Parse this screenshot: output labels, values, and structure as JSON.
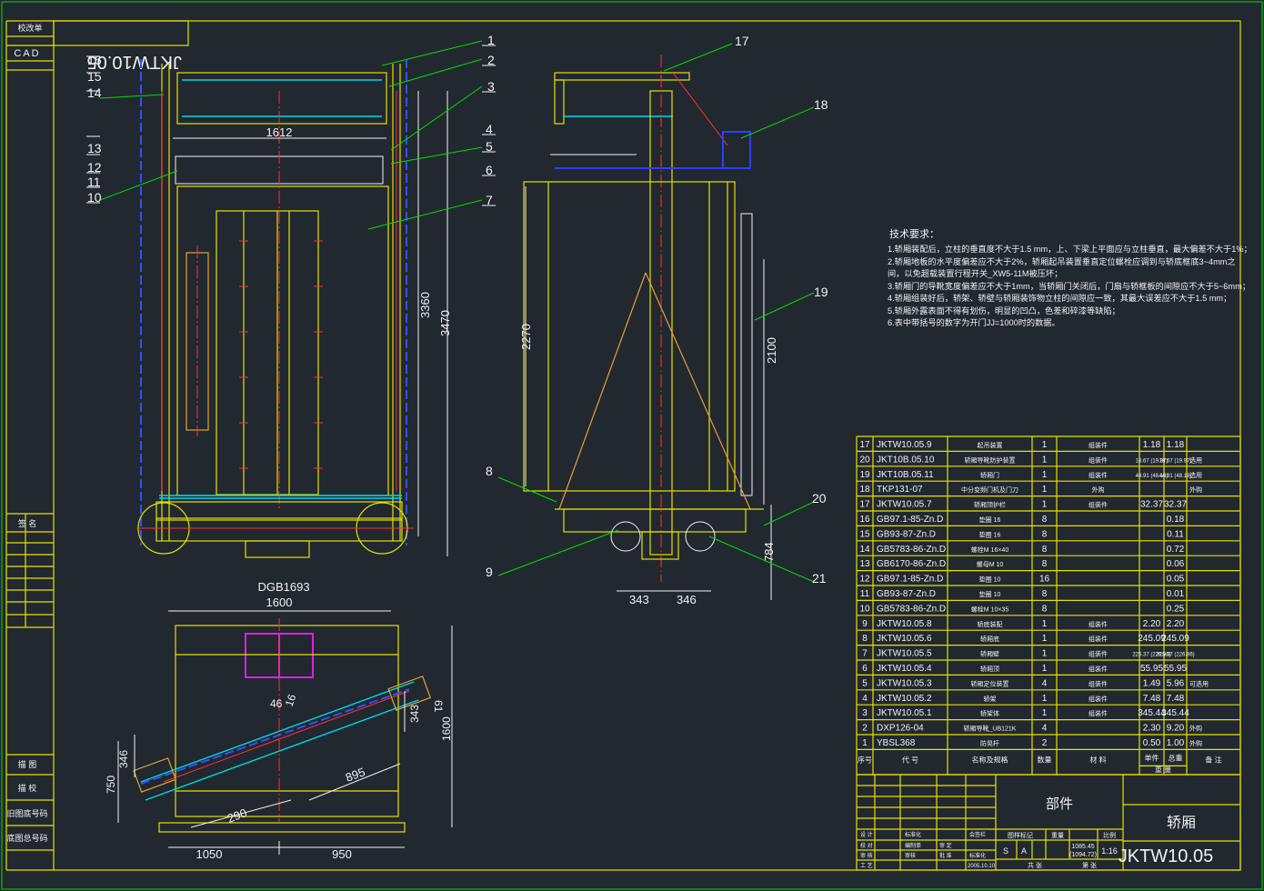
{
  "title_block": {
    "drawing_code_mirror": "JKTW10.05",
    "drawing_code": "JKTW10.05",
    "part_name": "轿厢",
    "category": "部件",
    "scale": "1:16",
    "stage_s": "S",
    "stage_a": "A",
    "mass": "1085.45",
    "mass2": "(1094.72)",
    "date": "2005.10.10",
    "sign_rows": [
      [
        "设 计",
        "",
        "标准化",
        "",
        "会签栏"
      ],
      [
        "校 对",
        "",
        "编制单",
        "审 定",
        ""
      ],
      [
        "审 核",
        "",
        "审核",
        "批 准",
        "标准化"
      ],
      [
        "工 艺",
        "",
        "",
        "",
        "2005.10.10"
      ]
    ],
    "foot_labels": [
      "共 张",
      "第 张"
    ],
    "col_labels": [
      "图样标记",
      "重量",
      "比例"
    ]
  },
  "left_strip": {
    "top_labels": [
      "校改单",
      "CAD"
    ],
    "mid_label": "签 名",
    "bottom_labels": [
      "描 图",
      "描 校",
      "旧图底号码",
      "底图总号码"
    ]
  },
  "tech_req": {
    "title": "技术要求：",
    "lines": [
      "1.轿厢装配后，立柱的垂直度不大于1.5 mm，上、下梁上平面应与立柱垂直，最大偏差不大于1%；",
      "2.轿厢地板的水平度偏差应不大于2%，轿厢起吊装置垂直定位螺栓应调到与轿底框底3~4mm之",
      "间，以免超载装置行程开关_XW5-11M被压坏；",
      "3.轿厢门的导靴宽度偏差应不大于1mm，当轿厢门关闭后，门扇与轿框板的间隙应不大于5~6mm；",
      "4.轿厢组装好后，轿架、轿壁与轿厢装饰物立柱的间隙应一致，其最大误差应不大于1.5 mm；",
      "5.轿厢外露表面不得有划伤，明显的凹凸，色差和碎漆等缺陷；",
      "6.表中带括号的数字为开门JJ=1000时的数据。"
    ]
  },
  "bom_header": [
    "序号",
    "代 号",
    "名称及规格",
    "数量",
    "材 料",
    "单件",
    "总重",
    "备 注"
  ],
  "bom_header_sub": "重 量",
  "bom": [
    [
      "17",
      "JKTW10.05.9",
      "起吊装置",
      "1",
      "组装件",
      "1.18",
      "1.18",
      ""
    ],
    [
      "20",
      "JKT10B.05.10",
      "轿厢导靴防护装置",
      "1",
      "组装件",
      "18.67 (19.97)",
      "18.67 (19.97)",
      "选用"
    ],
    [
      "19",
      "JKT10B.05.11",
      "轿厢门",
      "1",
      "组装件",
      "44.91 (48.19)",
      "44.91 (48.19)",
      "选用"
    ],
    [
      "18",
      "TKP131-07",
      "中分变频门机及门刀",
      "1",
      "外购",
      "",
      "",
      "外购"
    ],
    [
      "17",
      "JKTW10.05.7",
      "轿厢顶护栏",
      "1",
      "组装件",
      "32.37",
      "32.37",
      ""
    ],
    [
      "16",
      "GB97.1-85-Zn.D",
      "垫圈 16",
      "8",
      "",
      "",
      "0.18",
      ""
    ],
    [
      "15",
      "GB93-87-Zn.D",
      "垫圈 16",
      "8",
      "",
      "",
      "0.11",
      ""
    ],
    [
      "14",
      "GB5783-86-Zn.D",
      "螺栓M 16×40",
      "8",
      "",
      "",
      "0.72",
      ""
    ],
    [
      "13",
      "GB6170-86-Zn.D",
      "螺母M 10",
      "8",
      "",
      "",
      "0.06",
      ""
    ],
    [
      "12",
      "GB97.1-85-Zn.D",
      "垫圈 10",
      "16",
      "",
      "",
      "0.05",
      ""
    ],
    [
      "11",
      "GB93-87-Zn.D",
      "垫圈 10",
      "8",
      "",
      "",
      "0.01",
      ""
    ],
    [
      "10",
      "GB5783-86-Zn.D",
      "螺栓M 10×35",
      "8",
      "",
      "",
      "0.25",
      ""
    ],
    [
      "9",
      "JKTW10.05.8",
      "轿底装配",
      "1",
      "组装件",
      "2.20",
      "2.20",
      ""
    ],
    [
      "8",
      "JKTW10.05.6",
      "轿厢底",
      "1",
      "组装件",
      "245.09",
      "245.09",
      ""
    ],
    [
      "7",
      "JKTW10.05.5",
      "轿厢壁",
      "1",
      "组装件",
      "225.37 (226.86)",
      "225.37 (226.86)",
      ""
    ],
    [
      "6",
      "JKTW10.05.4",
      "轿厢顶",
      "1",
      "组装件",
      "55.95",
      "55.95",
      ""
    ],
    [
      "5",
      "JKTW10.05.3",
      "轿厢定位装置",
      "4",
      "组装件",
      "1.49",
      "5.96",
      "可选用"
    ],
    [
      "4",
      "JKTW10.05.2",
      "轿架",
      "1",
      "组装件",
      "7.48",
      "7.48",
      ""
    ],
    [
      "3",
      "JKTW10.05.1",
      "轿架体",
      "1",
      "组装件",
      "345.44",
      "345.44",
      ""
    ],
    [
      "2",
      "DXP126-04",
      "轿厢导靴_UB121K",
      "4",
      "",
      "2.30",
      "9.20",
      "外购"
    ],
    [
      "1",
      "YBSL368",
      "防晃杆",
      "2",
      "",
      "0.50",
      "1.00",
      "外购"
    ]
  ],
  "front_view": {
    "labels": [
      "1",
      "2",
      "3",
      "4",
      "5",
      "6",
      "7",
      "8",
      "9",
      "10",
      "11",
      "12",
      "13",
      "14",
      "15",
      "16",
      "17",
      "18",
      "19",
      "20",
      "21"
    ],
    "dims": [
      "1612",
      "3360",
      "3470"
    ]
  },
  "side_view": {
    "dims": [
      "2270",
      "2100",
      "784",
      "343",
      "346"
    ]
  },
  "plan_view": {
    "title": "DGB1693",
    "dims": [
      "1600",
      "46",
      "16",
      "343",
      "61",
      "1600",
      "346",
      "750",
      "895",
      "290",
      "1050",
      "950"
    ]
  }
}
